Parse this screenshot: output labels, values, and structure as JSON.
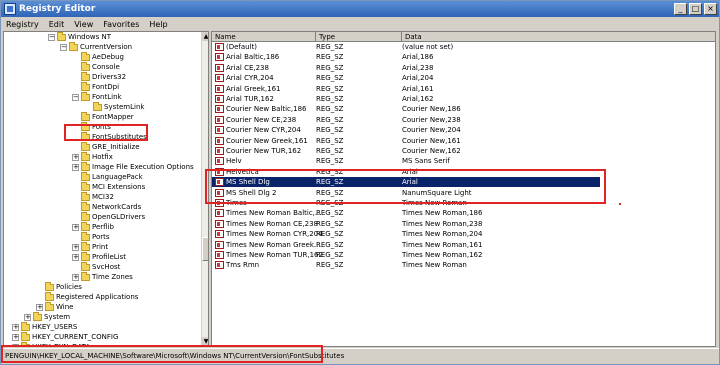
{
  "window": {
    "title": "Registry Editor"
  },
  "menu": [
    "Registry",
    "Edit",
    "View",
    "Favorites",
    "Help"
  ],
  "title_controls": [
    "minimize",
    "maximize",
    "close"
  ],
  "tree": {
    "items": [
      {
        "label": "Windows NT",
        "exp": "−",
        "icon": "folder"
      },
      {
        "label": "CurrentVersion",
        "exp": "−",
        "icon": "folder"
      },
      {
        "label": "AeDebug",
        "exp": "",
        "icon": "folder"
      },
      {
        "label": "Console",
        "exp": "",
        "icon": "folder"
      },
      {
        "label": "Drivers32",
        "exp": "",
        "icon": "folder"
      },
      {
        "label": "FontDpi",
        "exp": "",
        "icon": "folder"
      },
      {
        "label": "FontLink",
        "exp": "−",
        "icon": "folder"
      },
      {
        "label": "SystemLink",
        "exp": "",
        "icon": "folder"
      },
      {
        "label": "FontMapper",
        "exp": "",
        "icon": "folder"
      },
      {
        "label": "Fonts",
        "exp": "",
        "icon": "folder"
      },
      {
        "label": "FontSubstitutes",
        "exp": "",
        "icon": "folder"
      },
      {
        "label": "GRE_Initialize",
        "exp": "",
        "icon": "folder"
      },
      {
        "label": "Hotfix",
        "exp": "+",
        "icon": "folder"
      },
      {
        "label": "Image File Execution Options",
        "exp": "+",
        "icon": "folder"
      },
      {
        "label": "LanguagePack",
        "exp": "",
        "icon": "folder"
      },
      {
        "label": "MCI Extensions",
        "exp": "",
        "icon": "folder"
      },
      {
        "label": "MCI32",
        "exp": "",
        "icon": "folder"
      },
      {
        "label": "NetworkCards",
        "exp": "",
        "icon": "folder"
      },
      {
        "label": "OpenGLDrivers",
        "exp": "",
        "icon": "folder"
      },
      {
        "label": "Perflib",
        "exp": "+",
        "icon": "folder"
      },
      {
        "label": "Ports",
        "exp": "",
        "icon": "folder"
      },
      {
        "label": "Print",
        "exp": "+",
        "icon": "folder"
      },
      {
        "label": "ProfileList",
        "exp": "+",
        "icon": "folder"
      },
      {
        "label": "SvcHost",
        "exp": "",
        "icon": "folder"
      },
      {
        "label": "Time Zones",
        "exp": "+",
        "icon": "folder"
      },
      {
        "label": "Policies",
        "exp": "",
        "icon": "folder"
      },
      {
        "label": "Registered Applications",
        "exp": "",
        "icon": "folder"
      },
      {
        "label": "Wine",
        "exp": "+",
        "icon": "folder"
      },
      {
        "label": "System",
        "exp": "+",
        "icon": "folder"
      },
      {
        "label": "HKEY_USERS",
        "exp": "+",
        "icon": "folder"
      },
      {
        "label": "HKEY_CURRENT_CONFIG",
        "exp": "+",
        "icon": "folder"
      },
      {
        "label": "HKEY_DYN_DATA",
        "exp": "+",
        "icon": "folder"
      }
    ]
  },
  "list": {
    "headers": [
      "Name",
      "Type",
      "Data"
    ],
    "rows": [
      {
        "name": "(Default)",
        "type": "REG_SZ",
        "data": "(value not set)"
      },
      {
        "name": "Arial Baltic,186",
        "type": "REG_SZ",
        "data": "Arial,186"
      },
      {
        "name": "Arial CE,238",
        "type": "REG_SZ",
        "data": "Arial,238"
      },
      {
        "name": "Arial CYR,204",
        "type": "REG_SZ",
        "data": "Arial,204"
      },
      {
        "name": "Arial Greek,161",
        "type": "REG_SZ",
        "data": "Arial,161"
      },
      {
        "name": "Arial TUR,162",
        "type": "REG_SZ",
        "data": "Arial,162"
      },
      {
        "name": "Courier New Baltic,186",
        "type": "REG_SZ",
        "data": "Courier New,186"
      },
      {
        "name": "Courier New CE,238",
        "type": "REG_SZ",
        "data": "Courier New,238"
      },
      {
        "name": "Courier New CYR,204",
        "type": "REG_SZ",
        "data": "Courier New,204"
      },
      {
        "name": "Courier New Greek,161",
        "type": "REG_SZ",
        "data": "Courier New,161"
      },
      {
        "name": "Courier New TUR,162",
        "type": "REG_SZ",
        "data": "Courier New,162"
      },
      {
        "name": "Helv",
        "type": "REG_SZ",
        "data": "MS Sans Serif"
      },
      {
        "name": "Helvetica",
        "type": "REG_SZ",
        "data": "Arial"
      },
      {
        "name": "MS Shell Dlg",
        "type": "REG_SZ",
        "data": "Arial"
      },
      {
        "name": "MS Shell Dlg 2",
        "type": "REG_SZ",
        "data": "NanumSquare Light"
      },
      {
        "name": "Times",
        "type": "REG_SZ",
        "data": "Times New Roman"
      },
      {
        "name": "Times New Roman Baltic,...",
        "type": "REG_SZ",
        "data": "Times New Roman,186"
      },
      {
        "name": "Times New Roman CE,238",
        "type": "REG_SZ",
        "data": "Times New Roman,238"
      },
      {
        "name": "Times New Roman CYR,204",
        "type": "REG_SZ",
        "data": "Times New Roman,204"
      },
      {
        "name": "Times New Roman Greek...",
        "type": "REG_SZ",
        "data": "Times New Roman,161"
      },
      {
        "name": "Times New Roman TUR,162",
        "type": "REG_SZ",
        "data": "Times New Roman,162"
      },
      {
        "name": "Tms Rmn",
        "type": "REG_SZ",
        "data": "Times New Roman"
      }
    ],
    "selected_name": "MS Shell Dlg"
  },
  "statusbar": {
    "path": "PENGUIN\\HKEY_LOCAL_MACHINE\\Software\\Microsoft\\Windows NT\\CurrentVersion\\FontSubstitutes"
  },
  "colors": {
    "selection": "#0a246a",
    "highlight": "#e02424",
    "titlebar": "#2f64b8"
  }
}
